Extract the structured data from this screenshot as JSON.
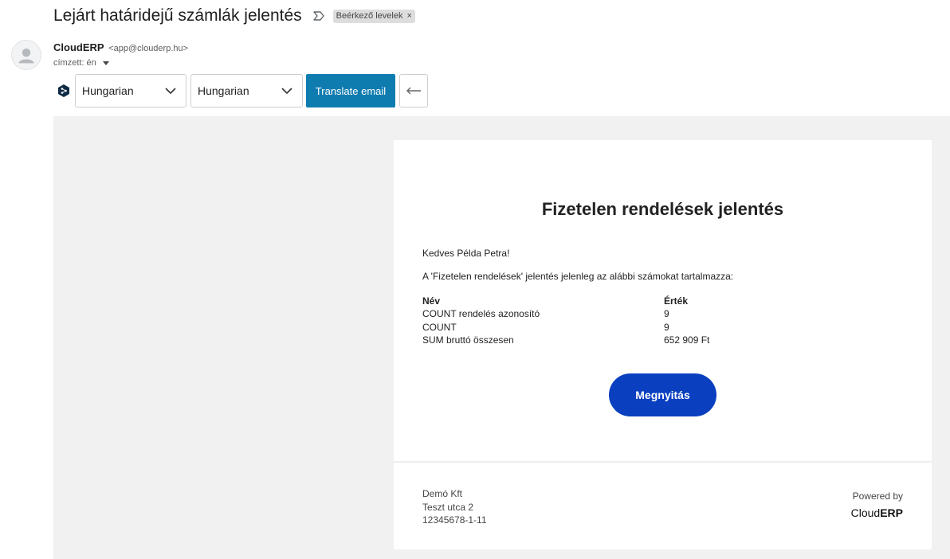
{
  "subject": {
    "title": "Lejárt határidejű számlák jelentés",
    "label_chip": "Beérkező levelek",
    "chip_close": "×"
  },
  "sender": {
    "name": "CloudERP",
    "email": "<app@clouderp.hu>",
    "recipient": "címzett: én"
  },
  "translate_bar": {
    "source_language": "Hungarian",
    "target_language": "Hungarian",
    "translate_button": "Translate email",
    "accent_color": "#0f7cb0"
  },
  "email": {
    "title": "Fizetelen rendelések jelentés",
    "greeting": "Kedves Példa Petra!",
    "intro": "A 'Fizetelen rendelések' jelentés jelenleg az alábbi számokat tartalmazza:",
    "table": {
      "headers": [
        "Név",
        "Érték"
      ],
      "rows": [
        [
          "COUNT rendelés azonosító",
          "9"
        ],
        [
          "COUNT",
          "9"
        ],
        [
          "SUM bruttó összesen",
          "652 909 Ft"
        ]
      ]
    },
    "open_button": "Megnyitás",
    "button_color": "#0a3fbf",
    "footer": {
      "company_name": "Demó Kft",
      "address": "Teszt utca 2",
      "tax_id": "12345678-1-11",
      "powered_by": "Powered by",
      "brand_light": "Cloud",
      "brand_bold": "ERP"
    }
  }
}
